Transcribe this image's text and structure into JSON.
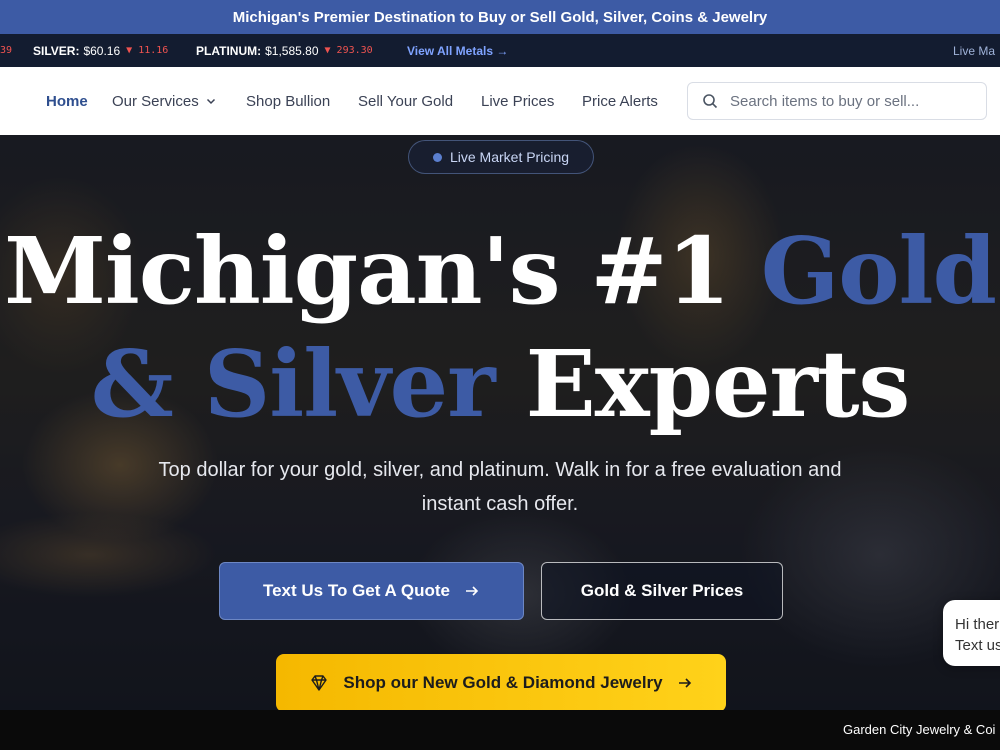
{
  "promo": {
    "text": "Michigan's Premier Destination to Buy or Sell Gold, Silver, Coins & Jewelry"
  },
  "ticker": {
    "prev_cut": "39",
    "silver": {
      "label": "SILVER:",
      "price": "$60.16",
      "change": "11.16"
    },
    "platinum": {
      "label": "PLATINUM:",
      "price": "$1,585.80",
      "change": "293.30"
    },
    "view_all": "View All Metals →",
    "right_cut": "Live Ma"
  },
  "nav": {
    "home": "Home",
    "services": "Our Services",
    "shop_bullion": "Shop Bullion",
    "sell_gold": "Sell Your Gold",
    "live_prices": "Live Prices",
    "price_alerts": "Price Alerts",
    "search_placeholder": "Search items to buy or sell..."
  },
  "hero": {
    "badge": "Live Market Pricing",
    "title_part1": "Michigan's #1 ",
    "title_gold": "Gold",
    "title_amp_silver": "& Silver",
    "title_experts": " Experts",
    "subtitle": "Top dollar for your gold, silver, and platinum. Walk in for a free evaluation and instant cash offer.",
    "cta_primary": "Text Us To Get A Quote",
    "cta_secondary": "Gold & Silver Prices",
    "cta_jewelry": "Shop our New Gold & Diamond Jewelry"
  },
  "chat": {
    "line1": "Hi ther",
    "line2": "Text us"
  },
  "footer": {
    "text": "Garden City Jewelry & Coi"
  },
  "colors": {
    "brand_blue": "#3d5ba5",
    "gold": "#f5b800",
    "ticker_bg": "#131c30",
    "down_red": "#ef5350"
  }
}
